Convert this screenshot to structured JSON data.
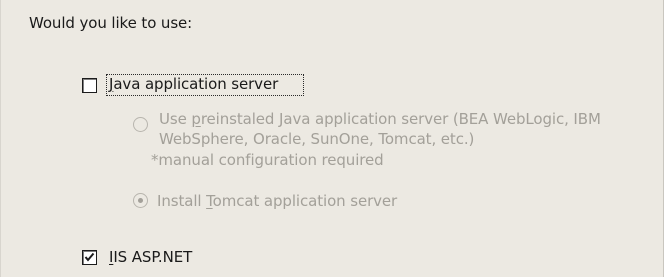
{
  "prompt": "Would you like to use:",
  "java": {
    "prefix": "",
    "mnemonic": "J",
    "rest": "ava application server",
    "checked": false
  },
  "preinstalled": {
    "line1_pre": "Use ",
    "line1_mnemonic": "p",
    "line1_rest": "reinstaled Java application server (BEA WebLogic, IBM",
    "line2": "WebSphere, Oracle, SunOne, Tomcat, etc.)",
    "note": "*manual configuration required",
    "selected": false
  },
  "install_tomcat": {
    "pre": "Install ",
    "mnemonic": "T",
    "rest": "omcat application server",
    "selected": true
  },
  "iis": {
    "mnemonic": "I",
    "rest": "IS ASP.NET",
    "checked": true
  }
}
